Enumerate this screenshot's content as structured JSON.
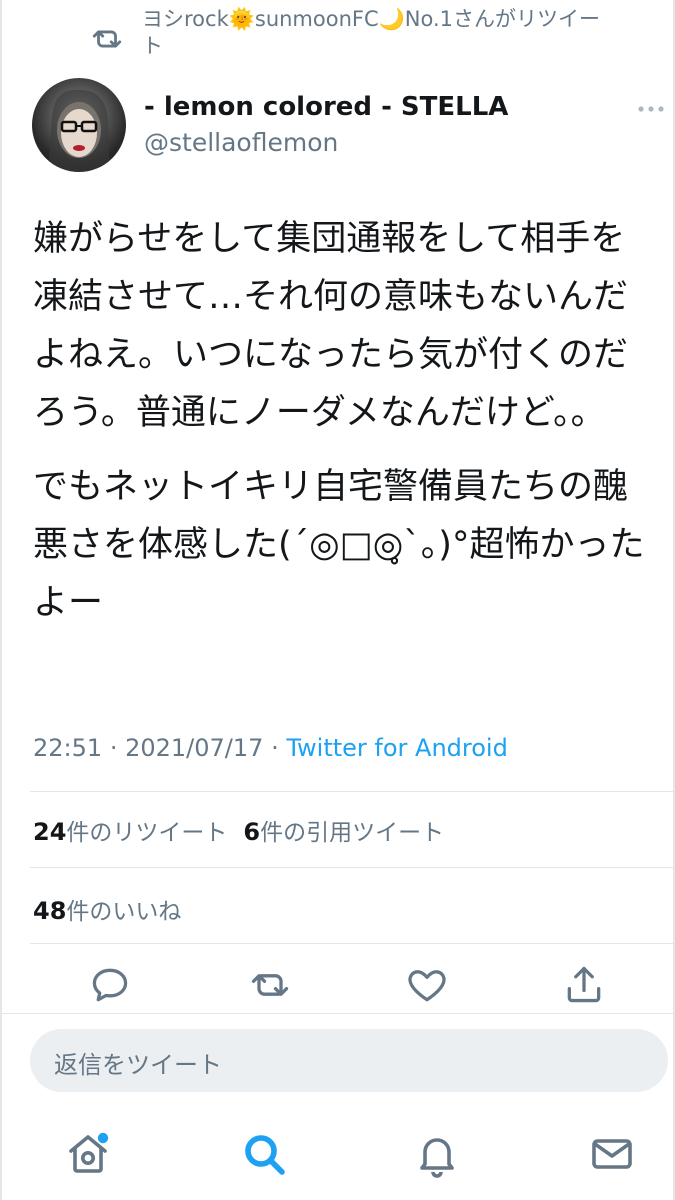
{
  "retweet_context": {
    "text": "ヨシrock🌞sunmoonFC🌙No.1さんがリツイート",
    "icon": "retweet-icon"
  },
  "tweet": {
    "author": {
      "display_name": "- lemon colored - STELLA",
      "handle": "@stellaoflemon",
      "avatar": "avatar-photo"
    },
    "paragraphs": [
      "嫌がらせをして集団通報をして相手を凍結させて…それ何の意味もないんだよねえ。いつになったら気が付くのだろう。普通にノーダメなんだけど。。",
      "でもネットイキリ自宅警備員たちの醜悪さを体感した(´◎□◎̥`。)°超怖かったよー"
    ],
    "time": "22:51",
    "date": "2021/07/17",
    "separator": "·",
    "source": "Twitter for Android"
  },
  "stats": {
    "retweets_count": "24",
    "retweets_label": "件のリツイート",
    "quotes_count": "6",
    "quotes_label": "件の引用ツイート",
    "likes_count": "48",
    "likes_label": "件のいいね"
  },
  "actions": [
    "reply-icon",
    "retweet-icon",
    "like-heart-icon",
    "share-icon"
  ],
  "reply": {
    "placeholder": "返信をツイート"
  },
  "tab_bar": {
    "tabs": [
      "home-icon",
      "search-icon",
      "notifications-bell-icon",
      "messages-mail-icon"
    ],
    "active": "search-icon",
    "home_badge": true
  },
  "colors": {
    "accent": "#1da1f2",
    "secondary_text": "#657786",
    "primary_text": "#14171a",
    "divider": "#e1e8ed",
    "reply_box_bg": "#eceff2"
  }
}
